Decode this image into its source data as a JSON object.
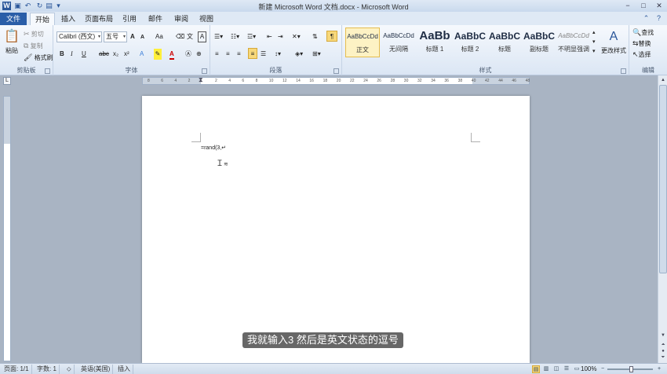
{
  "window": {
    "title": "新建 Microsoft Word 文档.docx - Microsoft Word",
    "qa_icons": [
      "word-logo-icon",
      "save-icon",
      "undo-icon",
      "redo-icon",
      "print-preview-icon",
      "customize-icon"
    ],
    "buttons": {
      "minimize": "−",
      "maximize": "□",
      "close": "✕"
    }
  },
  "tabs": [
    {
      "label": "文件"
    },
    {
      "label": "开始"
    },
    {
      "label": "插入"
    },
    {
      "label": "页面布局"
    },
    {
      "label": "引用"
    },
    {
      "label": "邮件"
    },
    {
      "label": "审阅"
    },
    {
      "label": "视图"
    }
  ],
  "ribbon": {
    "clipboard": {
      "label": "剪贴板",
      "paste": "粘贴",
      "cut": "剪切",
      "copy": "复制",
      "format_painter": "格式刷"
    },
    "font": {
      "label": "字体",
      "font_name": "Calibri (西文)",
      "font_size": "五号",
      "grow": "A",
      "shrink": "A",
      "case": "Aa",
      "bold": "B",
      "italic": "I",
      "underline": "U",
      "strike": "abc",
      "sub": "x₂",
      "sup": "x²",
      "color_a": "A"
    },
    "paragraph": {
      "label": "段落"
    },
    "styles": {
      "label": "样式",
      "items": [
        {
          "sample": "AaBbCcDd",
          "name": "正文"
        },
        {
          "sample": "AaBbCcDd",
          "name": "无间隔"
        },
        {
          "sample": "AaBb",
          "name": "标题 1"
        },
        {
          "sample": "AaBbC",
          "name": "标题 2"
        },
        {
          "sample": "AaBbC",
          "name": "标题"
        },
        {
          "sample": "AaBbC",
          "name": "副标题"
        },
        {
          "sample": "AaBbCcDd",
          "name": "不明显强调"
        }
      ],
      "change_styles": "更改样式"
    },
    "editing": {
      "label": "编辑",
      "find": "查找",
      "replace": "替换",
      "select": "选择"
    }
  },
  "ruler": {
    "ticks": [
      "8",
      "6",
      "4",
      "2",
      "",
      "2",
      "4",
      "6",
      "8",
      "10",
      "12",
      "14",
      "16",
      "18",
      "20",
      "22",
      "24",
      "26",
      "28",
      "30",
      "32",
      "34",
      "36",
      "38",
      "40",
      "42",
      "44",
      "46",
      "48"
    ]
  },
  "document": {
    "text": "=rand(3,↵"
  },
  "subtitle": "我就输入3  然后是英文状态的逗号",
  "statusbar": {
    "page": "页面: 1/1",
    "words": "字数: 1",
    "language": "英语(美国)",
    "mode": "插入",
    "zoom": "100%"
  }
}
